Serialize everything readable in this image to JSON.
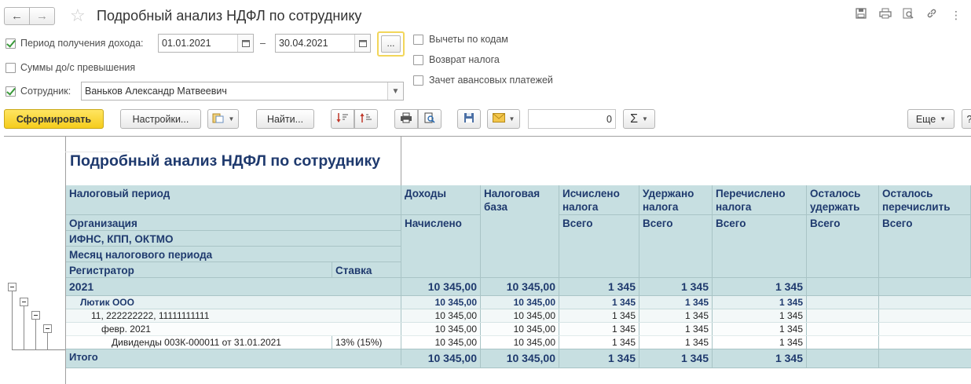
{
  "window": {
    "title": "Подробный анализ НДФЛ по сотруднику"
  },
  "form": {
    "period": {
      "label": "Период получения дохода:",
      "checked": true,
      "from": "01.01.2021",
      "dash": "–",
      "to": "30.04.2021",
      "picker_label": "..."
    },
    "sums_label": "Суммы до/с превышения",
    "employee": {
      "label": "Сотрудник:",
      "checked": true,
      "value": "Ваньков Александр Матвеевич"
    },
    "options": [
      {
        "label": "Вычеты по кодам",
        "checked": false
      },
      {
        "label": "Возврат налога",
        "checked": false
      },
      {
        "label": "Зачет авансовых платежей",
        "checked": false
      }
    ]
  },
  "toolbar": {
    "generate": "Сформировать",
    "settings": "Настройки...",
    "find": "Найти...",
    "amount": "0",
    "sum_symbol": "Σ",
    "more": "Еще"
  },
  "report": {
    "title": "Подробный анализ НДФЛ по сотруднику",
    "headers": {
      "tax_period": "Налоговый период",
      "organization": "Организация",
      "ifns": "ИФНС, КПП, ОКТМО",
      "month": "Месяц налогового периода",
      "registrar": "Регистратор",
      "rate": "Ставка",
      "income": "Доходы",
      "accrued": "Начислено",
      "tax_base": "Налоговая база",
      "calculated": "Исчислено налога",
      "withheld": "Удержано налога",
      "transferred": "Перечислено налога",
      "left_withhold": "Осталось удержать",
      "left_transfer": "Осталось перечислить",
      "total_word": "Всего"
    },
    "rows": {
      "year": {
        "label": "2021",
        "income": "10 345,00",
        "base": "10 345,00",
        "calc": "1 345",
        "withheld": "1 345",
        "transferred": "1 345"
      },
      "org": {
        "label": "Лютик ООО",
        "income": "10 345,00",
        "base": "10 345,00",
        "calc": "1 345",
        "withheld": "1 345",
        "transferred": "1 345"
      },
      "ifns": {
        "label": "11, 222222222, 11111111111",
        "income": "10 345,00",
        "base": "10 345,00",
        "calc": "1 345",
        "withheld": "1 345",
        "transferred": "1 345"
      },
      "month": {
        "label": "февр. 2021",
        "income": "10 345,00",
        "base": "10 345,00",
        "calc": "1 345",
        "withheld": "1 345",
        "transferred": "1 345"
      },
      "registrar": {
        "label": "Дивиденды 003К-000011 от 31.01.2021",
        "rate": "13% (15%)",
        "income": "10 345,00",
        "base": "10 345,00",
        "calc": "1 345",
        "withheld": "1 345",
        "transferred": "1 345"
      },
      "total": {
        "label": "Итого",
        "income": "10 345,00",
        "base": "10 345,00",
        "calc": "1 345",
        "withheld": "1 345",
        "transferred": "1 345"
      }
    }
  }
}
